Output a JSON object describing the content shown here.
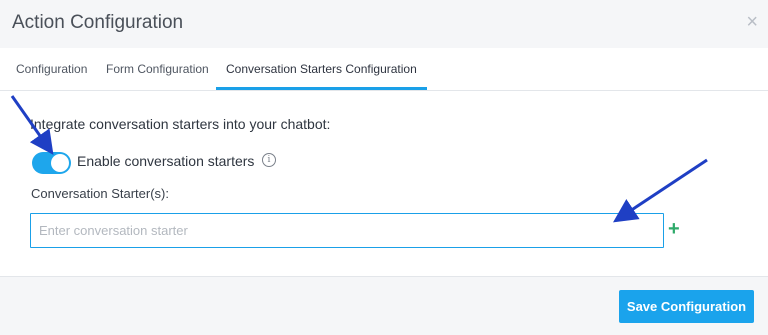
{
  "modal": {
    "title": "Action Configuration",
    "close_icon": "×"
  },
  "tabs": [
    {
      "label": "Configuration",
      "active": false
    },
    {
      "label": "Form Configuration",
      "active": false
    },
    {
      "label": "Conversation Starters Configuration",
      "active": true
    }
  ],
  "content": {
    "intro_text": "Integrate conversation starters into your chatbot:",
    "toggle": {
      "label": "Enable conversation starters",
      "enabled": true,
      "info_icon": "i"
    },
    "starters_label": "Conversation Starter(s):",
    "starter_input": {
      "value": "",
      "placeholder": "Enter conversation starter"
    },
    "add_icon": "+"
  },
  "footer": {
    "save_label": "Save Configuration"
  },
  "colors": {
    "accent": "#1aa3ec",
    "add_green": "#2eaa6a",
    "annotation_arrow": "#1f3fc4"
  }
}
